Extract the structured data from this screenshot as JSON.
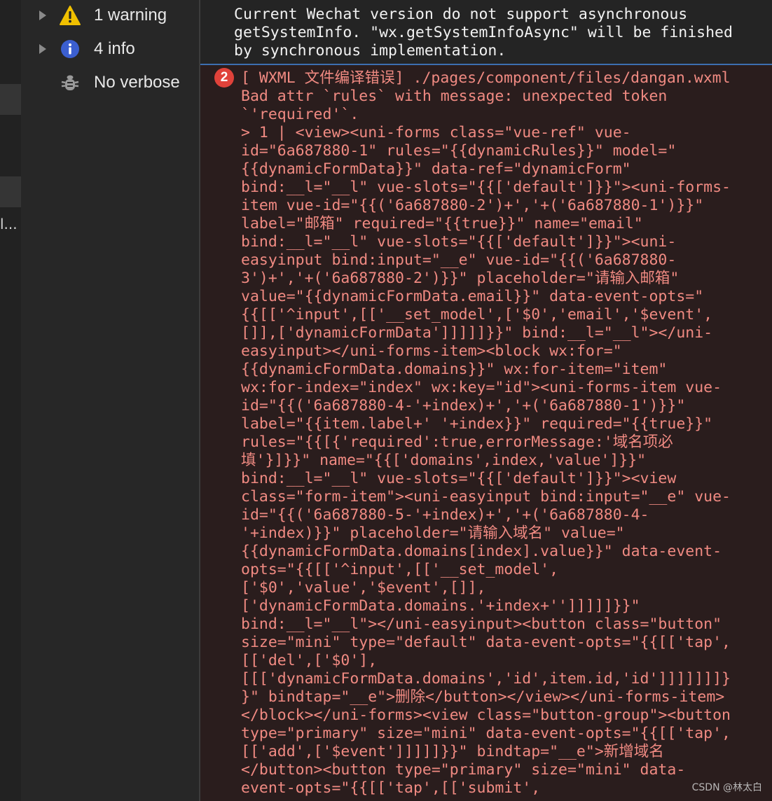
{
  "sidebar": {
    "filters": [
      {
        "label": "1 warning",
        "icon": "warning-icon"
      },
      {
        "label": "4 info",
        "icon": "info-icon"
      },
      {
        "label": "No verbose",
        "icon": "bug-icon"
      }
    ],
    "truncated_tab_text": "l..."
  },
  "console": {
    "warning_message": "Current Wechat version do not support asynchronous\ngetSystemInfo. \"wx.getSystemInfoAsync\" will be finished\nby synchronous implementation.",
    "error": {
      "count": "2",
      "lines": [
        "[ WXML 文件编译错误] ./pages/component/files/dangan.wxml",
        "Bad attr `rules` with message: unexpected token",
        "`'required'`.",
        "> 1 | <view><uni-forms class=\"vue-ref\" vue-",
        "id=\"6a687880-1\" rules=\"{{dynamicRules}}\" model=\"",
        "{{dynamicFormData}}\" data-ref=\"dynamicForm\"",
        "bind:__l=\"__l\" vue-slots=\"{{['default']}}\"><uni-forms-",
        "item vue-id=\"{{('6a687880-2')+','+('6a687880-1')}}\"",
        "label=\"邮箱\" required=\"{{true}}\" name=\"email\"",
        "bind:__l=\"__l\" vue-slots=\"{{['default']}}\"><uni-",
        "easyinput bind:input=\"__e\" vue-id=\"{{('6a687880-",
        "3')+','+('6a687880-2')}}\" placeholder=\"请输入邮箱\"",
        "value=\"{{dynamicFormData.email}}\" data-event-opts=\"",
        "{{[['^input',[['__set_model',['$0','email','$event',",
        "[]],['dynamicFormData']]]]]}}\" bind:__l=\"__l\"></uni-",
        "easyinput></uni-forms-item><block wx:for=\"",
        "{{dynamicFormData.domains}}\" wx:for-item=\"item\"",
        "wx:for-index=\"index\" wx:key=\"id\"><uni-forms-item vue-",
        "id=\"{{('6a687880-4-'+index)+','+('6a687880-1')}}\"",
        "label=\"{{item.label+' '+index}}\" required=\"{{true}}\"",
        "rules=\"{{[{'required':true,errorMessage:'域名项必",
        "填'}]}}\" name=\"{{['domains',index,'value']}}\"",
        "bind:__l=\"__l\" vue-slots=\"{{['default']}}\"><view",
        "class=\"form-item\"><uni-easyinput bind:input=\"__e\" vue-",
        "id=\"{{('6a687880-5-'+index)+','+('6a687880-4-",
        "'+index)}}\" placeholder=\"请输入域名\" value=\"",
        "{{dynamicFormData.domains[index].value}}\" data-event-",
        "opts=\"{{[['^input',[['__set_model',",
        "['$0','value','$event',[]],",
        "['dynamicFormData.domains.'+index+'']]]]]}}\"",
        "bind:__l=\"__l\"></uni-easyinput><button class=\"button\"",
        "size=\"mini\" type=\"default\" data-event-opts=\"{{[['tap',",
        "[['del',['$0'],",
        "[[['dynamicFormData.domains','id',item.id,'id']]]]]]]}",
        "}\" bindtap=\"__e\">删除</button></view></uni-forms-item>",
        "</block></uni-forms><view class=\"button-group\"><button",
        "type=\"primary\" size=\"mini\" data-event-opts=\"{{[['tap',",
        "[['add',['$event']]]]]}}\" bindtap=\"__e\">新增域名",
        "</button><button type=\"primary\" size=\"mini\" data-",
        "event-opts=\"{{[['tap',[['submit',"
      ]
    }
  },
  "watermark": "CSDN @林太白",
  "colors": {
    "warning_icon": "#f0c000",
    "info_icon": "#3b5fd0",
    "error_text": "#f08a82",
    "error_badge": "#e0423a",
    "error_background": "#2a1d1d",
    "separator_blue": "#3d6fb0"
  }
}
